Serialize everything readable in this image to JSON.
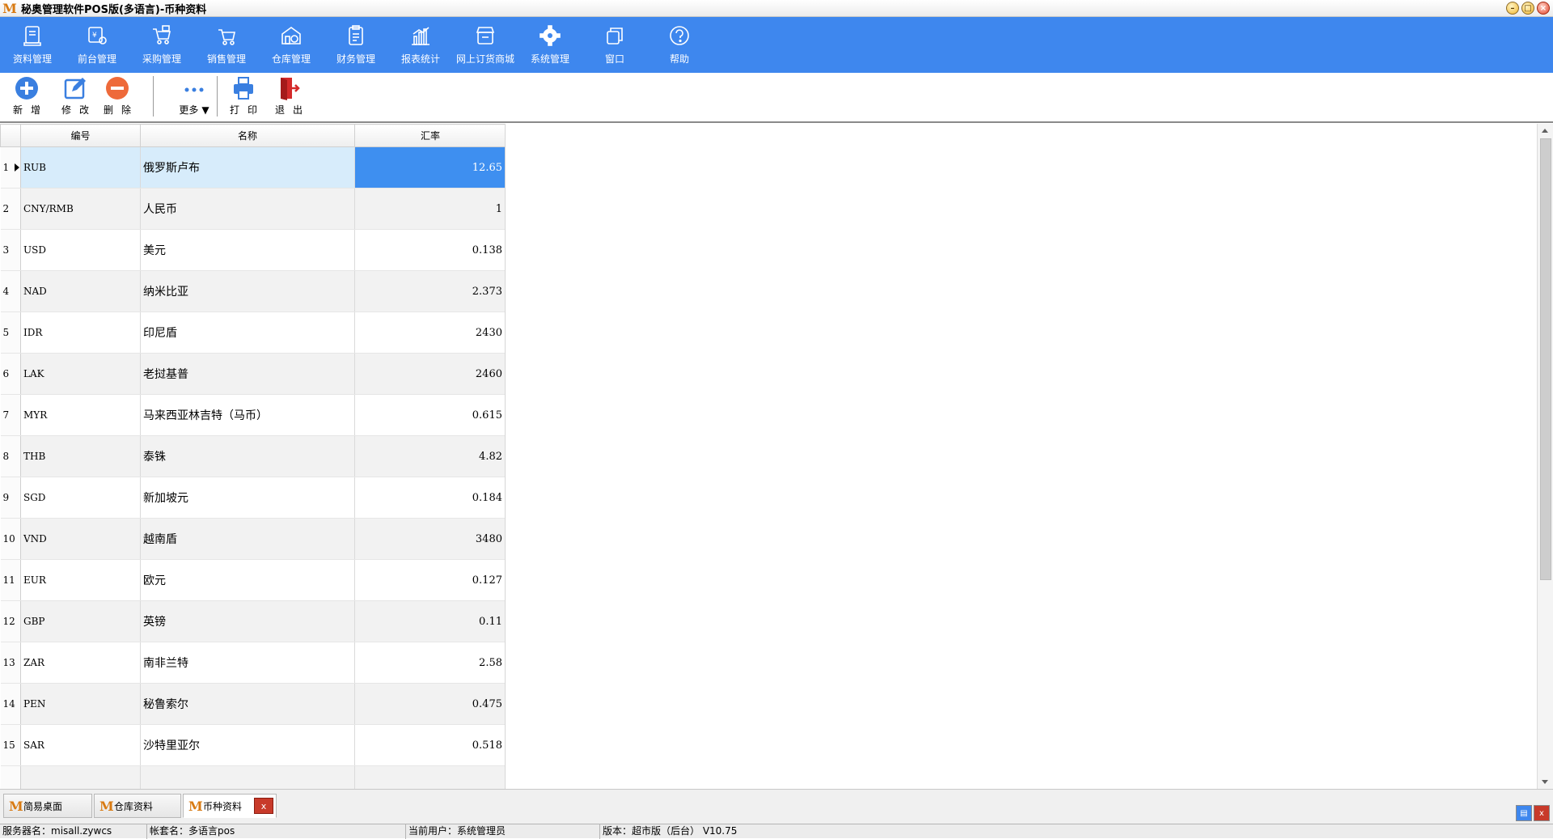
{
  "window": {
    "title": "秘奥管理软件POS版(多语言)-币种资料",
    "logo_char": "M",
    "icons": [
      "minimize-icon",
      "maximize-icon",
      "close-icon"
    ]
  },
  "main_menu": {
    "items": [
      {
        "label": "资料管理",
        "icon": "document-icon"
      },
      {
        "label": "前台管理",
        "icon": "pos-terminal-icon"
      },
      {
        "label": "采购管理",
        "icon": "purchase-cart-icon"
      },
      {
        "label": "销售管理",
        "icon": "shopping-cart-icon"
      },
      {
        "label": "仓库管理",
        "icon": "warehouse-icon"
      },
      {
        "label": "财务管理",
        "icon": "clipboard-icon"
      },
      {
        "label": "报表统计",
        "icon": "bar-chart-icon"
      },
      {
        "label": "网上订货商城",
        "icon": "store-icon"
      },
      {
        "label": "系统管理",
        "icon": "gear-icon"
      },
      {
        "label": "窗口",
        "icon": "windows-icon"
      },
      {
        "label": "帮助",
        "icon": "help-icon"
      }
    ]
  },
  "toolbar": {
    "add_label": "新增",
    "edit_label": "修改",
    "delete_label": "删除",
    "more_label": "更多",
    "print_label": "打印",
    "exit_label": "退出"
  },
  "grid": {
    "columns": [
      "编号",
      "名称",
      "汇率"
    ],
    "rows": [
      {
        "no": "1",
        "code": "RUB",
        "name": "俄罗斯卢布",
        "rate": "12.65"
      },
      {
        "no": "2",
        "code": "CNY/RMB",
        "name": "人民币",
        "rate": "1"
      },
      {
        "no": "3",
        "code": "USD",
        "name": "美元",
        "rate": "0.138"
      },
      {
        "no": "4",
        "code": "NAD",
        "name": "纳米比亚",
        "rate": "2.373"
      },
      {
        "no": "5",
        "code": "IDR",
        "name": "印尼盾",
        "rate": "2430"
      },
      {
        "no": "6",
        "code": "LAK",
        "name": "老挝基普",
        "rate": "2460"
      },
      {
        "no": "7",
        "code": "MYR",
        "name": "马来西亚林吉特（马币）",
        "rate": "0.615"
      },
      {
        "no": "8",
        "code": "THB",
        "name": "泰铢",
        "rate": "4.82"
      },
      {
        "no": "9",
        "code": "SGD",
        "name": "新加坡元",
        "rate": "0.184"
      },
      {
        "no": "10",
        "code": "VND",
        "name": "越南盾",
        "rate": "3480"
      },
      {
        "no": "11",
        "code": "EUR",
        "name": "欧元",
        "rate": "0.127"
      },
      {
        "no": "12",
        "code": "GBP",
        "name": "英镑",
        "rate": "0.11"
      },
      {
        "no": "13",
        "code": "ZAR",
        "name": "南非兰特",
        "rate": "2.58"
      },
      {
        "no": "14",
        "code": "PEN",
        "name": "秘鲁索尔",
        "rate": "0.475"
      },
      {
        "no": "15",
        "code": "SAR",
        "name": "沙特里亚尔",
        "rate": "0.518"
      },
      {
        "no": "",
        "code": "",
        "name": "",
        "rate": ""
      }
    ]
  },
  "tabs": [
    {
      "label": "简易桌面"
    },
    {
      "label": "仓库资料"
    },
    {
      "label": "币种资料",
      "active": true
    }
  ],
  "tab_close": "x",
  "corner": {
    "close": "x"
  },
  "status": {
    "server": "服务器名：misall.zywcs",
    "account": "帐套名：多语言pos",
    "user": "当前用户：系统管理员",
    "version": "版本：超市版（后台） V10.75"
  },
  "colors": {
    "menu_bg": "#3e87ee",
    "selected_cell": "#3e8ff0",
    "selected_row": "#d7ecfb",
    "add_button": "#3a7fe0",
    "delete_button": "#ee6a3a",
    "exit_button": "#d42a2a"
  }
}
